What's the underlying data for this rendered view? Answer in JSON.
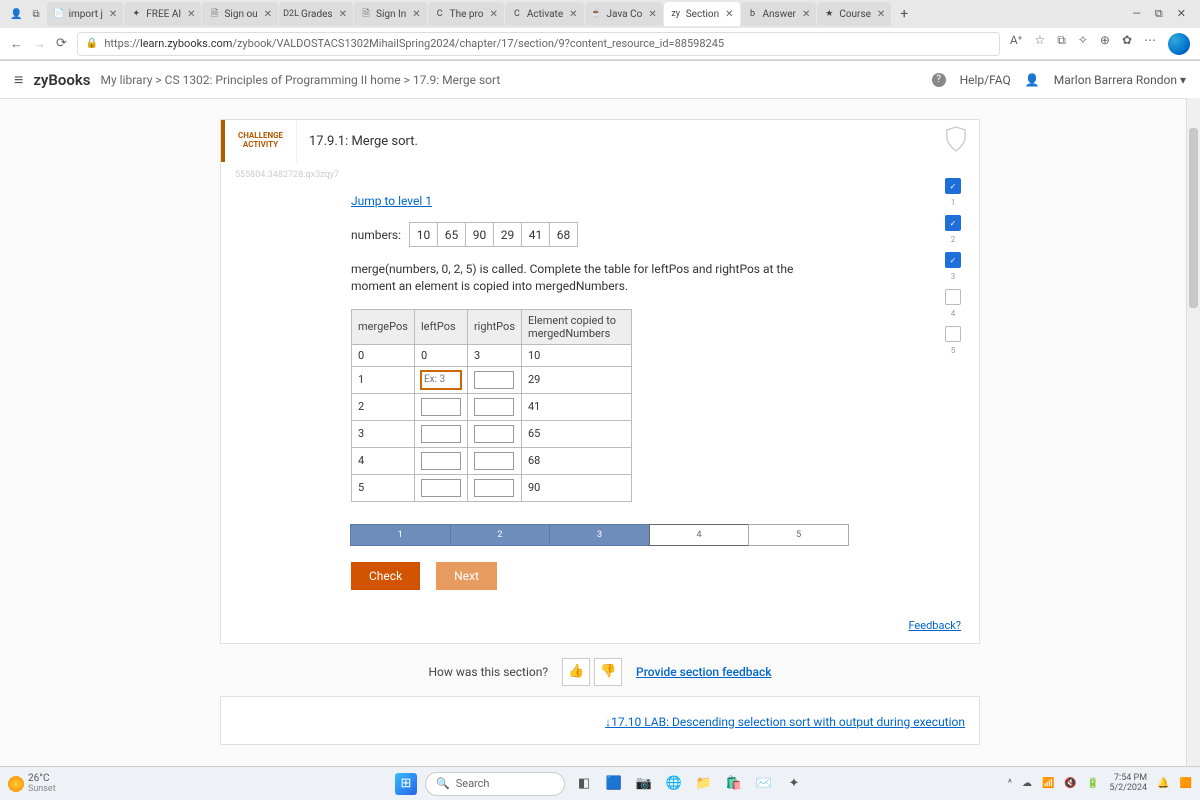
{
  "browser": {
    "tabs": [
      {
        "label": "import j",
        "fav": "📄"
      },
      {
        "label": "FREE AI",
        "fav": "✦"
      },
      {
        "label": "Sign ou",
        "fav": "🗎"
      },
      {
        "label": "Grades",
        "fav": "D2L"
      },
      {
        "label": "Sign In",
        "fav": "🗎"
      },
      {
        "label": "The pro",
        "fav": "C"
      },
      {
        "label": "Activate",
        "fav": "C"
      },
      {
        "label": "Java Co",
        "fav": "☕"
      },
      {
        "label": "Section",
        "fav": "zy",
        "active": true
      },
      {
        "label": "Answer",
        "fav": "b"
      },
      {
        "label": "Course",
        "fav": "★"
      }
    ],
    "url_prefix": "https://",
    "url_domain": "learn.zybooks.com",
    "url_path": "/zybook/VALDOSTACS1302MihailSpring2024/chapter/17/section/9?content_resource_id=88598245"
  },
  "header": {
    "logo": "zyBooks",
    "breadcrumb": "My library > CS 1302: Principles of Programming II home > 17.9: Merge sort",
    "help": "Help/FAQ",
    "user": "Marlon Barrera Rondon"
  },
  "activity": {
    "badge_l1": "CHALLENGE",
    "badge_l2": "ACTIVITY",
    "title": "17.9.1: Merge sort.",
    "qid": "555804.3482728.qx3zqy7",
    "jump": "Jump to level 1",
    "numbers_label": "numbers:",
    "numbers": [
      "10",
      "65",
      "90",
      "29",
      "41",
      "68"
    ],
    "prompt": "merge(numbers, 0, 2, 5) is called. Complete the table for leftPos and rightPos at the moment an element is copied into mergedNumbers.",
    "headers": {
      "c0": "mergePos",
      "c1": "leftPos",
      "c2": "rightPos",
      "c3": "Element copied to mergedNumbers"
    },
    "rows": [
      {
        "mp": "0",
        "lp": "0",
        "rp": "3",
        "el": "10",
        "lp_input": false,
        "rp_input": false
      },
      {
        "mp": "1",
        "lp": "",
        "rp": "",
        "el": "29",
        "lp_input": true,
        "rp_input": true,
        "lp_ph": "Ex: 3",
        "lp_focus": true
      },
      {
        "mp": "2",
        "lp": "",
        "rp": "",
        "el": "41",
        "lp_input": true,
        "rp_input": true
      },
      {
        "mp": "3",
        "lp": "",
        "rp": "",
        "el": "65",
        "lp_input": true,
        "rp_input": true
      },
      {
        "mp": "4",
        "lp": "",
        "rp": "",
        "el": "68",
        "lp_input": true,
        "rp_input": true
      },
      {
        "mp": "5",
        "lp": "",
        "rp": "",
        "el": "90",
        "lp_input": true,
        "rp_input": true
      }
    ],
    "steps": [
      {
        "n": "1",
        "state": "done"
      },
      {
        "n": "2",
        "state": "done"
      },
      {
        "n": "3",
        "state": "done"
      },
      {
        "n": "4",
        "state": "current"
      },
      {
        "n": "5",
        "state": ""
      }
    ],
    "check": "Check",
    "next": "Next",
    "rail": [
      {
        "n": "1",
        "done": true
      },
      {
        "n": "2",
        "done": true
      },
      {
        "n": "3",
        "done": true
      },
      {
        "n": "4",
        "done": false
      },
      {
        "n": "5",
        "done": false
      }
    ],
    "feedback": "Feedback?"
  },
  "section_feedback": {
    "q": "How was this section?",
    "provide": "Provide section feedback"
  },
  "next_lab": "↓17.10 LAB: Descending selection sort with output during execution",
  "taskbar": {
    "temp": "26°C",
    "cond": "Sunset",
    "search": "Search",
    "time": "7:54 PM",
    "date": "5/2/2024"
  }
}
